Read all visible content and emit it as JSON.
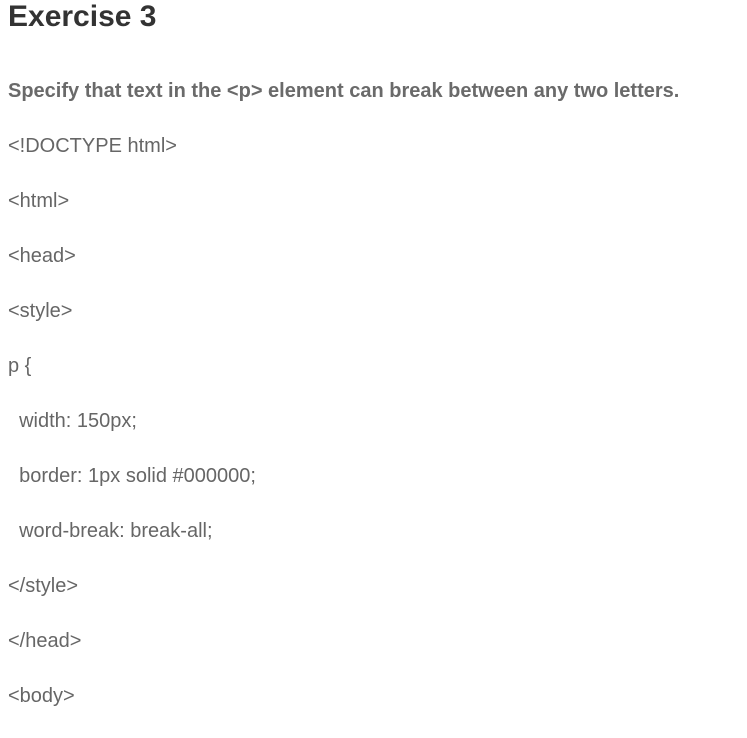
{
  "title": "Exercise 3",
  "instruction": "Specify that text in the <p> element can break between any two letters.",
  "code_lines": [
    "<!DOCTYPE html>",
    "<html>",
    "<head>",
    "<style>",
    "p {",
    "  width: 150px;",
    "  border: 1px solid #000000;",
    "  word-break: break-all;",
    "</style>",
    "</head>",
    "<body>"
  ]
}
